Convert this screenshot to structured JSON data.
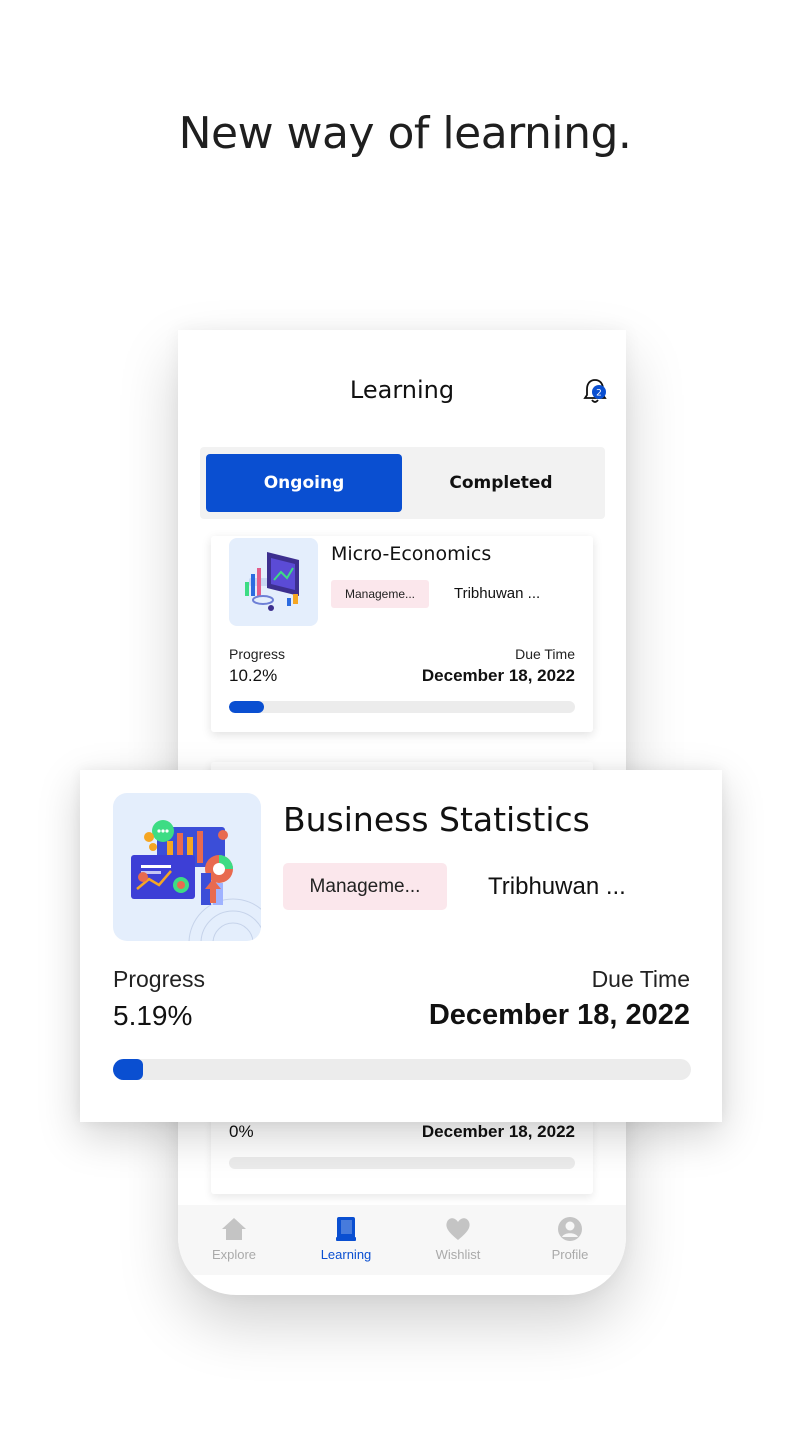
{
  "headline": "New way of learning.",
  "screen": {
    "title": "Learning",
    "notification_count": "2",
    "tabs": [
      {
        "label": "Ongoing",
        "active": true
      },
      {
        "label": "Completed",
        "active": false
      }
    ]
  },
  "courses": [
    {
      "title": "Micro-Economics",
      "category": "Manageme...",
      "university": "Tribhuwan ...",
      "progress_label": "Progress",
      "progress_value": "10.2%",
      "progress_fraction": 0.102,
      "due_label": "Due Time",
      "due_value": "December 18, 2022"
    },
    {
      "title": "Business Statistics",
      "category": "Manageme...",
      "university": "Tribhuwan ...",
      "progress_label": "Progress",
      "progress_value": "5.19%",
      "progress_fraction": 0.0519,
      "due_label": "Due Time",
      "due_value": "December 18, 2022"
    },
    {
      "progress_value": "0%",
      "progress_fraction": 0,
      "due_value": "December 18, 2022"
    }
  ],
  "bottom_nav": [
    {
      "label": "Explore",
      "icon": "home-icon",
      "active": false
    },
    {
      "label": "Learning",
      "icon": "book-icon",
      "active": true
    },
    {
      "label": "Wishlist",
      "icon": "heart-icon",
      "active": false
    },
    {
      "label": "Profile",
      "icon": "user-icon",
      "active": false
    }
  ],
  "colors": {
    "accent": "#0a4fd1",
    "chip_bg": "#fbe7ec",
    "track": "#ececec",
    "inactive": "#aaaaaa"
  }
}
